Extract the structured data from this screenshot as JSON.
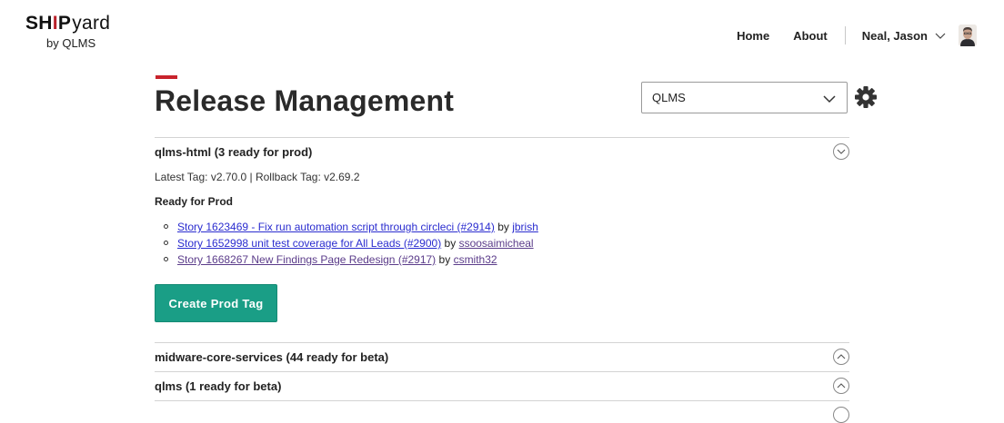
{
  "logo": {
    "ship": "SHIP",
    "yard": "yard",
    "by": "by QLMS"
  },
  "nav": {
    "home": "Home",
    "about": "About",
    "user": "Neal, Jason"
  },
  "page": {
    "title": "Release Management"
  },
  "project_select": {
    "value": "QLMS"
  },
  "colors": {
    "accent": "#c8232c",
    "primary_button": "#1a9e86",
    "link": "#2a2ccf",
    "visited_link": "#5b3c8a"
  },
  "sections": [
    {
      "title": "qlms-html (3 ready for prod)",
      "expanded": true,
      "tags_line": "Latest Tag: v2.70.0 | Rollback Tag: v2.69.2",
      "ready_label": "Ready for Prod",
      "stories": [
        {
          "link": "Story 1623469 - Fix run automation script through circleci (#2914)",
          "by": "by",
          "author": "jbrish"
        },
        {
          "link": "Story 1652998 unit test coverage for All Leads (#2900)",
          "by": "by",
          "author": "ssoosaimicheal"
        },
        {
          "link": "Story 1668267 New Findings Page Redesign (#2917)",
          "by": "by",
          "author": "csmith32"
        }
      ],
      "action": "Create Prod Tag"
    },
    {
      "title": "midware-core-services (44 ready for beta)",
      "expanded": false
    },
    {
      "title": "qlms (1 ready for beta)",
      "expanded": false
    }
  ],
  "icons": {
    "toggle_expanded": "chevron-down-icon",
    "toggle_collapsed": "chevron-up-icon",
    "settings": "gear-icon"
  }
}
